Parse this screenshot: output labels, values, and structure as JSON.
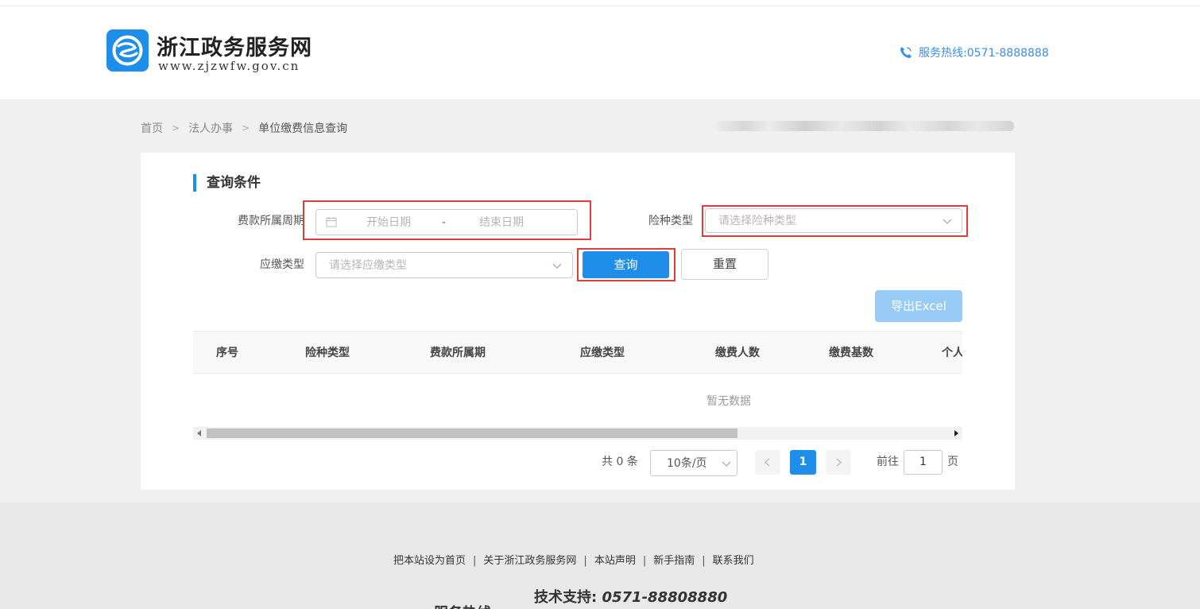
{
  "site": {
    "title": "浙江政务服务网",
    "url": "www.zjzwfw.gov.cn",
    "hotline": "服务热线:0571-8888888"
  },
  "breadcrumb": [
    "首页",
    "法人办事",
    "单位缴费信息查询"
  ],
  "query": {
    "section_title": "查询条件",
    "period_label": "费款所属周期",
    "start_placeholder": "开始日期",
    "range_sep": "-",
    "end_placeholder": "结束日期",
    "insurance_label": "险种类型",
    "insurance_placeholder": "请选择险种类型",
    "due_label": "应缴类型",
    "due_placeholder": "请选择应缴类型",
    "query_button": "查询",
    "reset_button": "重置",
    "export_button": "导出Excel"
  },
  "table": {
    "columns": [
      "序号",
      "险种类型",
      "费款所属期",
      "应缴类型",
      "缴费人数",
      "缴费基数",
      "个人"
    ],
    "empty_text": "暂无数据"
  },
  "pagination": {
    "total": "共 0 条",
    "page_size": "10条/页",
    "current_page": "1",
    "goto_label": "前往",
    "goto_value": "1",
    "goto_suffix": "页"
  },
  "footer": {
    "links": [
      "把本站设为首页",
      "关于浙江政务服务网",
      "本站声明",
      "新手指南",
      "联系我们"
    ],
    "tech_label": "技术支持:",
    "tech_phone": "0571-88808880",
    "cut_text": "服务热线"
  },
  "colors": {
    "accent": "#1e8ee9",
    "highlight_border": "#e23b3b",
    "export_disabled": "#98cbf6"
  }
}
